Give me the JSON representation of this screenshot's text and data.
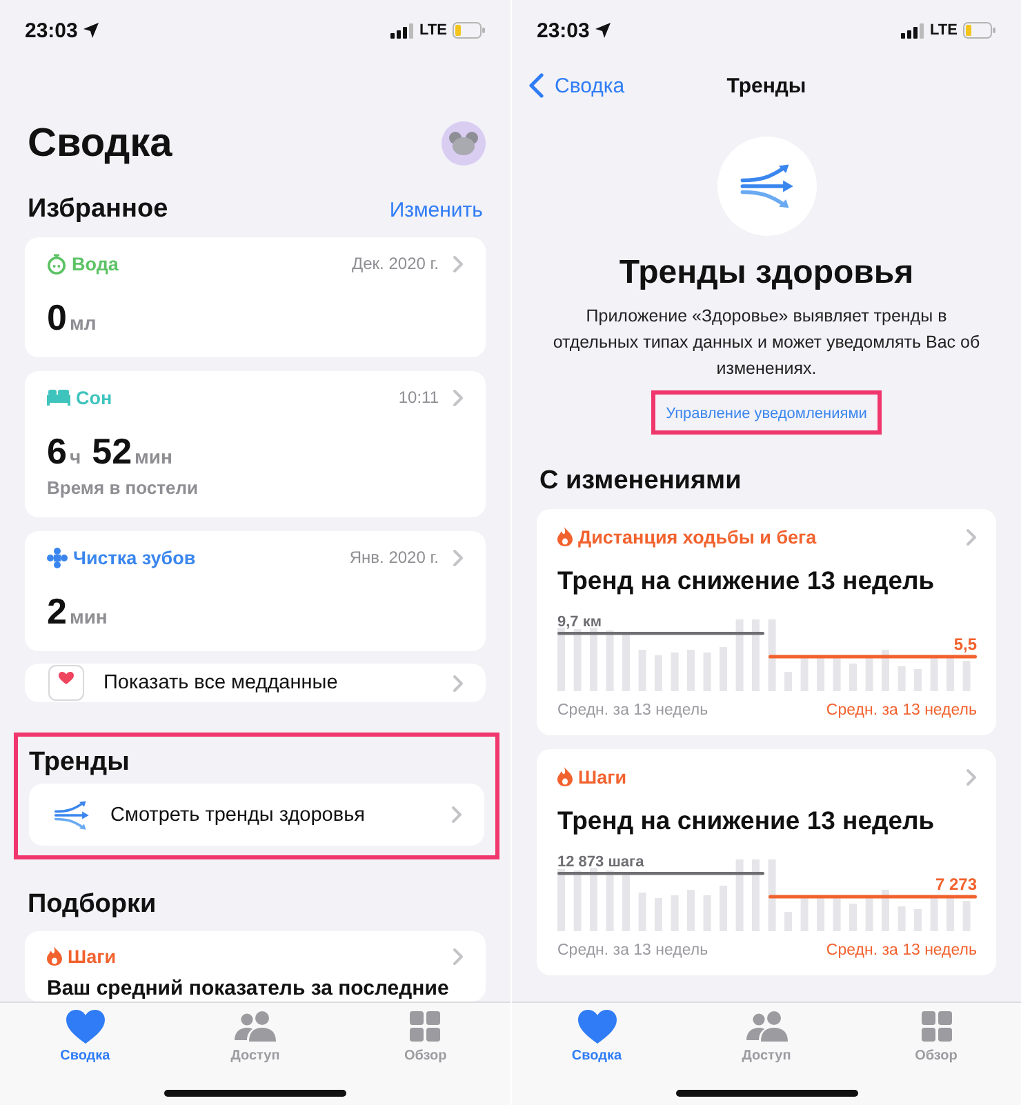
{
  "screens": [
    {
      "kind": "summary",
      "status_bar": {
        "time": "23:03",
        "network": "LTE"
      },
      "title": "Сводка",
      "favorites": {
        "heading": "Избранное",
        "edit_link": "Изменить",
        "cards": [
          {
            "kind": "water",
            "metric": "Вода",
            "color": "#5cc365",
            "date": "Дек. 2020 г.",
            "values": [
              {
                "number": "0",
                "unit": "мл"
              }
            ]
          },
          {
            "kind": "sleep",
            "metric": "Сон",
            "color": "#3fc4bd",
            "date": "10:11",
            "values": [
              {
                "number": "6",
                "unit": "ч"
              },
              {
                "number": "52",
                "unit": "мин"
              }
            ],
            "caption": "Время в постели"
          },
          {
            "kind": "brushing",
            "metric": "Чистка зубов",
            "color": "#3a86ee",
            "date": "Янв. 2020 г.",
            "values": [
              {
                "number": "2",
                "unit": "мин"
              }
            ]
          }
        ],
        "all_data_link": "Показать все медданные"
      },
      "trends": {
        "heading": "Тренды",
        "item": "Смотреть тренды здоровья",
        "highlighted": true
      },
      "highlights": {
        "heading": "Подборки",
        "cards": [
          {
            "metric": "Шаги",
            "text": "Ваш средний показатель за последние"
          }
        ]
      },
      "tab_bar": [
        {
          "kind": "summary",
          "label": "Сводка",
          "selected": true
        },
        {
          "kind": "sharing",
          "label": "Доступ",
          "selected": false
        },
        {
          "kind": "browse",
          "label": "Обзор",
          "selected": false
        }
      ]
    },
    {
      "kind": "trends",
      "status_bar": {
        "time": "23:03",
        "network": "LTE"
      },
      "nav": {
        "back": "Сводка",
        "title": "Тренды"
      },
      "hero": {
        "title": "Тренды здоровья",
        "description": "Приложение «Здоровье» выявляет тренды в отдельных типах данных и может уведомлять Вас об изменениях.",
        "link": "Управление уведомлениями",
        "highlighted": true
      },
      "changes": {
        "heading": "С изменениями",
        "cards": [
          {
            "metric": "Дистанция ходьбы и бега",
            "title": "Тренд на снижение 13 недель",
            "before_value": "9,7 км",
            "after_value": "5,5",
            "before_caption": "Средн. за 13 недель",
            "after_caption": "Средн. за 13 недель"
          },
          {
            "metric": "Шаги",
            "title": "Тренд на снижение 13 недель",
            "before_value": "12 873 шага",
            "after_value": "7 273",
            "before_caption": "Средн. за 13 недель",
            "after_caption": "Средн. за 13 недель"
          }
        ]
      },
      "tab_bar": [
        {
          "kind": "summary",
          "label": "Сводка",
          "selected": true
        },
        {
          "kind": "sharing",
          "label": "Доступ",
          "selected": false
        },
        {
          "kind": "browse",
          "label": "Обзор",
          "selected": false
        }
      ]
    }
  ]
}
